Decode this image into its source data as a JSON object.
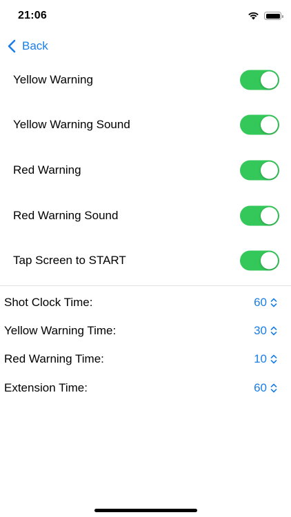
{
  "status_bar": {
    "time": "21:06",
    "icons": [
      "wifi-icon",
      "battery-icon"
    ]
  },
  "nav": {
    "back_label": "Back",
    "back_icon": "chevron-left-icon"
  },
  "toggles": [
    {
      "label": "Yellow Warning",
      "on": true
    },
    {
      "label": "Yellow Warning Sound",
      "on": true
    },
    {
      "label": "Red Warning",
      "on": true
    },
    {
      "label": "Red Warning Sound",
      "on": true
    },
    {
      "label": "Tap Screen to START",
      "on": true
    }
  ],
  "pickers": [
    {
      "label": "Shot Clock Time:",
      "value": "60"
    },
    {
      "label": "Yellow Warning Time:",
      "value": "30"
    },
    {
      "label": "Red Warning Time:",
      "value": "10"
    },
    {
      "label": "Extension Time:",
      "value": "60"
    }
  ],
  "colors": {
    "accent": "#1a7ee6",
    "toggle_on": "#34c759",
    "divider": "#e2e2e4"
  }
}
